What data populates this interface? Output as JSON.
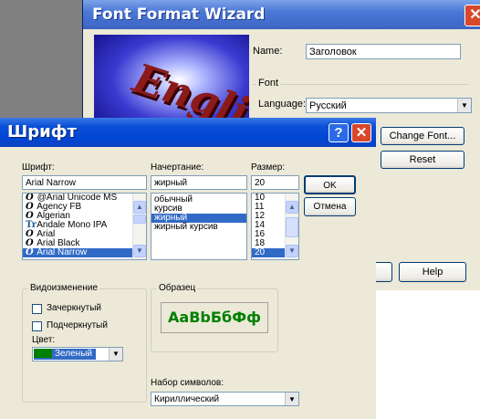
{
  "wizard": {
    "title": "Font Format Wizard",
    "close_glyph": "✕",
    "preview_text": "English",
    "name_label": "Name:",
    "name_value": "Заголовок",
    "font_group_label": "Font",
    "language_label": "Language:",
    "language_value": "Русский",
    "change_font_label": "Change Font...",
    "reset_label": "Reset",
    "help_label": "Help"
  },
  "dialog": {
    "title": "Шрифт",
    "help_glyph": "?",
    "close_glyph": "✕",
    "font_label": "Шрифт:",
    "font_value": "Arial Narrow",
    "fonts": [
      {
        "icon": "O",
        "type": "opentype",
        "name": "@Arial Unicode MS"
      },
      {
        "icon": "O",
        "type": "opentype",
        "name": "Agency FB"
      },
      {
        "icon": "O",
        "type": "opentype",
        "name": "Algerian"
      },
      {
        "icon": "Tr",
        "type": "truetype",
        "name": "Andale Mono IPA"
      },
      {
        "icon": "O",
        "type": "opentype",
        "name": "Arial"
      },
      {
        "icon": "O",
        "type": "opentype",
        "name": "Arial Black"
      },
      {
        "icon": "O",
        "type": "opentype",
        "name": "Arial Narrow"
      }
    ],
    "style_label": "Начертание:",
    "style_value": "жирный",
    "styles": [
      "обычный",
      "курсив",
      "жирный",
      "жирный курсив"
    ],
    "size_label": "Размер:",
    "size_value": "20",
    "sizes": [
      "10",
      "11",
      "12",
      "14",
      "16",
      "18",
      "20"
    ],
    "ok_label": "OK",
    "cancel_label": "Отмена",
    "effects_label": "Видоизменение",
    "strikeout_label": "Зачеркнутый",
    "underline_label": "Подчеркнутый",
    "color_label": "Цвет:",
    "color_value": "Зеленый",
    "color_hex": "#008000",
    "sample_label": "Образец",
    "sample_text": "AaBbБбФф",
    "charset_label": "Набор символов:",
    "charset_value": "Кириллический"
  }
}
